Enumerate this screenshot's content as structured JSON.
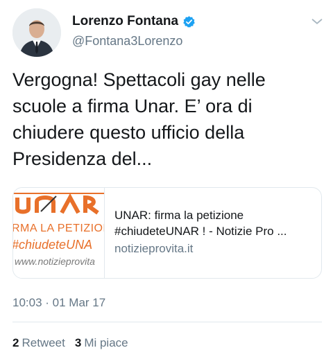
{
  "user": {
    "display_name": "Lorenzo Fontana",
    "handle": "@Fontana3Lorenzo",
    "verified_icon": "verified-badge-icon"
  },
  "tweet": {
    "text": "Vergogna! Spettacoli gay nelle\nscuole a firma Unar. E’ ora di\nchiudere questo ufficio della\nPresidenza del..."
  },
  "card": {
    "thumb_line1": "RMA LA PETIZION",
    "thumb_line2": "#chiudeteUNA",
    "thumb_line3": "www.notizieprovita",
    "title": "UNAR: firma la petizione #chiudeteUNAR ! - Notizie Pro ...",
    "domain": "notizieprovita.it"
  },
  "timestamp": "10:03 · 01 Mar 17",
  "stats": {
    "retweets_count": "2",
    "retweets_label": "Retweet",
    "likes_count": "3",
    "likes_label": "Mi piace"
  },
  "colors": {
    "accent": "#1da1f2",
    "secondary_text": "#657786",
    "thumb_orange": "#e8702a"
  }
}
